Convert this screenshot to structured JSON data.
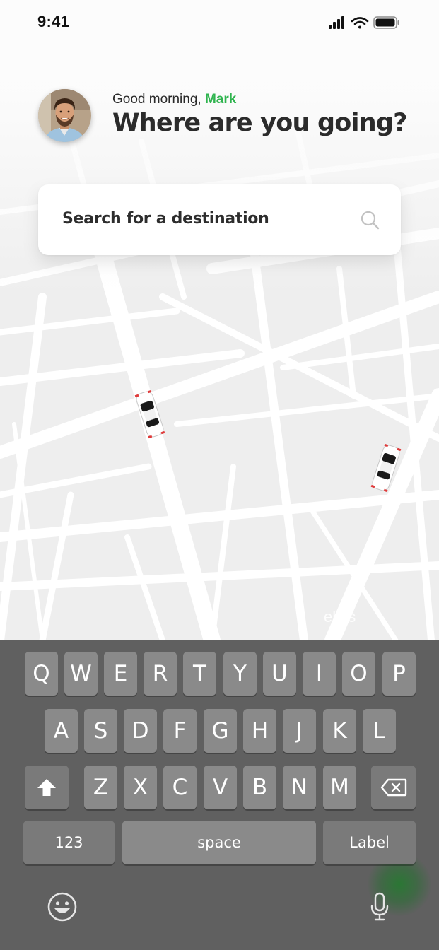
{
  "status_bar": {
    "time": "9:41",
    "icons": [
      "cellular-signal-icon",
      "wifi-icon",
      "battery-icon"
    ]
  },
  "header": {
    "greeting_prefix": "Good morning, ",
    "user_name": "Mark",
    "headline": "Where are you going?"
  },
  "search": {
    "placeholder": "Search for a destination",
    "icon": "search-icon"
  },
  "map": {
    "watermark": "ellos",
    "cars": [
      "car-icon",
      "car-icon"
    ]
  },
  "keyboard": {
    "row1": [
      "Q",
      "W",
      "E",
      "R",
      "T",
      "Y",
      "U",
      "I",
      "O",
      "P"
    ],
    "row2": [
      "A",
      "S",
      "D",
      "F",
      "G",
      "H",
      "J",
      "K",
      "L"
    ],
    "row3": [
      "Z",
      "X",
      "C",
      "V",
      "B",
      "N",
      "M"
    ],
    "shift_icon": "shift-icon",
    "backspace_icon": "backspace-icon",
    "numbers_key": "123",
    "space_key": "space",
    "return_key": "Label",
    "emoji_icon": "emoji-icon",
    "mic_icon": "microphone-icon"
  },
  "colors": {
    "accent": "#2fb44f",
    "keyboard_bg": "#606060",
    "key_bg": "#8a8a8a"
  }
}
